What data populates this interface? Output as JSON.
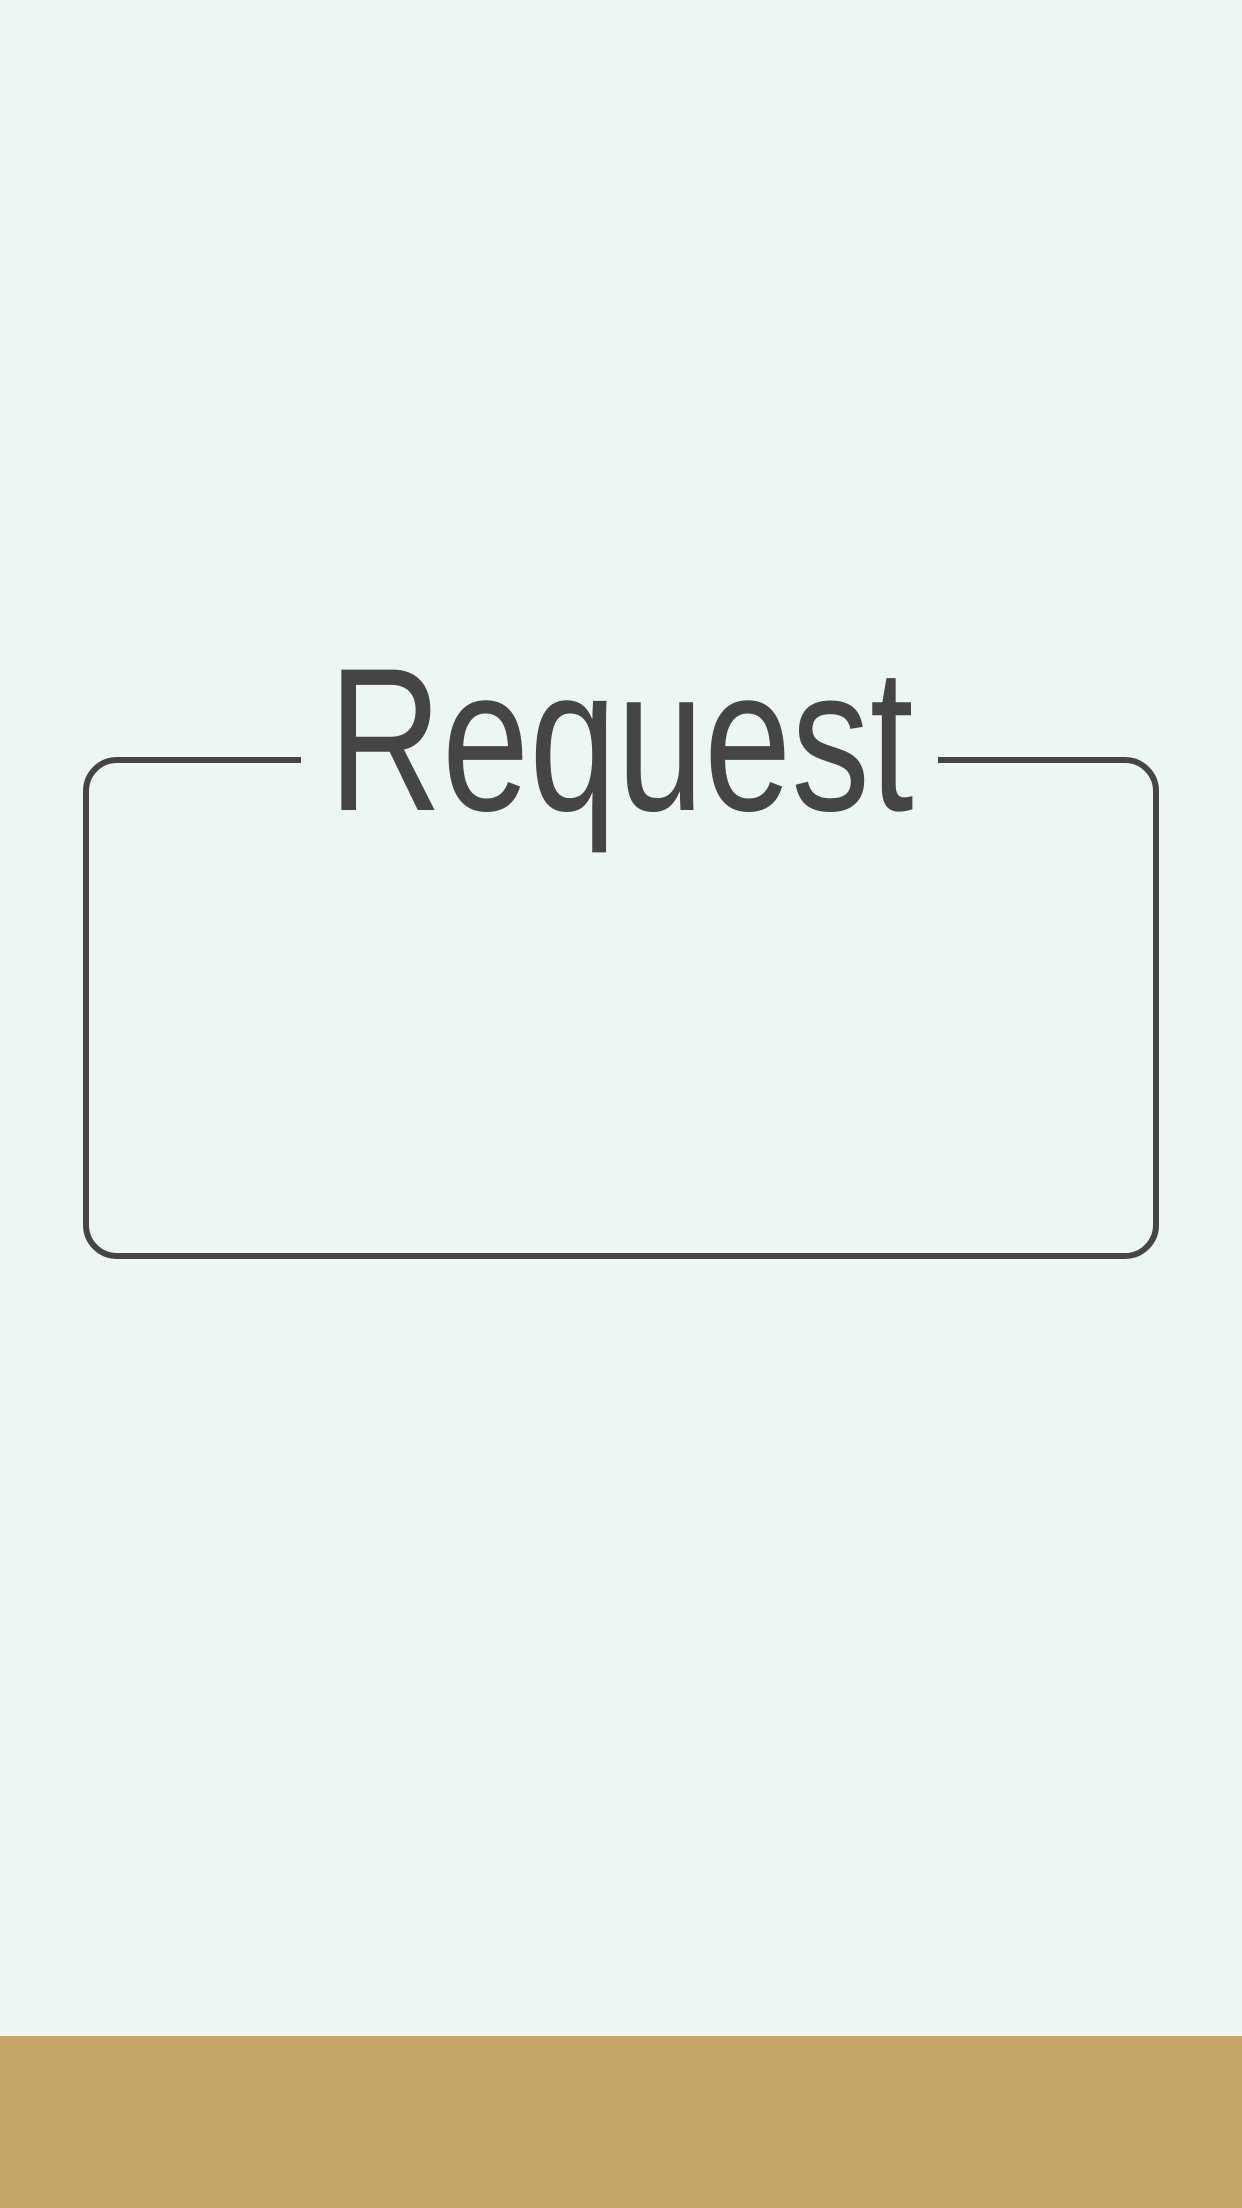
{
  "request_card": {
    "title": "Request"
  },
  "colors": {
    "background": "#EBF6F5",
    "border": "#454545",
    "bottom_bar": "#C7A66B"
  }
}
